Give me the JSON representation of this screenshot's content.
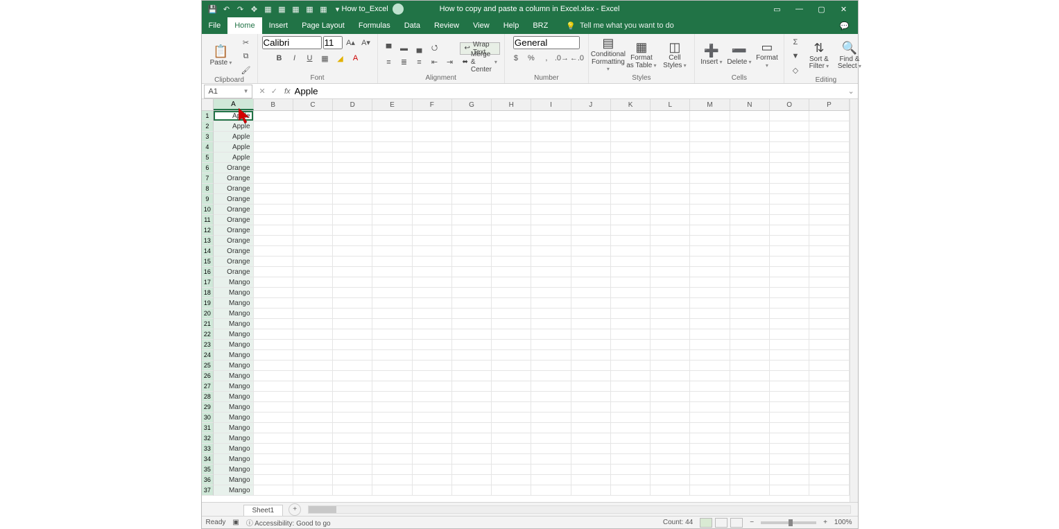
{
  "titlebar": {
    "doc_title": "How to copy and paste a column in Excel.xlsx - Excel",
    "account_name": "How to_Excel"
  },
  "menu": {
    "tabs": [
      "File",
      "Home",
      "Insert",
      "Page Layout",
      "Formulas",
      "Data",
      "Review",
      "View",
      "Help",
      "BRZ"
    ],
    "active": "Home",
    "tellme": "Tell me what you want to do"
  },
  "ribbon": {
    "clipboard": {
      "label": "Clipboard",
      "paste": "Paste"
    },
    "font": {
      "label": "Font",
      "name": "Calibri",
      "size": "11"
    },
    "alignment": {
      "label": "Alignment",
      "wrap": "Wrap Text",
      "merge": "Merge & Center"
    },
    "number": {
      "label": "Number",
      "format": "General"
    },
    "styles": {
      "label": "Styles",
      "cond": "Conditional Formatting",
      "table": "Format as Table",
      "cell": "Cell Styles"
    },
    "cells": {
      "label": "Cells",
      "insert": "Insert",
      "delete": "Delete",
      "format": "Format"
    },
    "editing": {
      "label": "Editing",
      "sort": "Sort & Filter",
      "find": "Find & Select"
    }
  },
  "formula": {
    "namebox": "A1",
    "value": "Apple"
  },
  "columns": [
    "A",
    "B",
    "C",
    "D",
    "E",
    "F",
    "G",
    "H",
    "I",
    "J",
    "K",
    "L",
    "M",
    "N",
    "O",
    "P"
  ],
  "selected_col": "A",
  "active_cell": "A1",
  "cells_colA": [
    "Apple",
    "Apple",
    "Apple",
    "Apple",
    "Apple",
    "Orange",
    "Orange",
    "Orange",
    "Orange",
    "Orange",
    "Orange",
    "Orange",
    "Orange",
    "Orange",
    "Orange",
    "Orange",
    "Mango",
    "Mango",
    "Mango",
    "Mango",
    "Mango",
    "Mango",
    "Mango",
    "Mango",
    "Mango",
    "Mango",
    "Mango",
    "Mango",
    "Mango",
    "Mango",
    "Mango",
    "Mango",
    "Mango",
    "Mango",
    "Mango",
    "Mango",
    "Mango"
  ],
  "sheets": {
    "active": "Sheet1"
  },
  "status": {
    "ready": "Ready",
    "accessibility": "Accessibility: Good to go",
    "count": "Count: 44",
    "zoom": "100%"
  }
}
